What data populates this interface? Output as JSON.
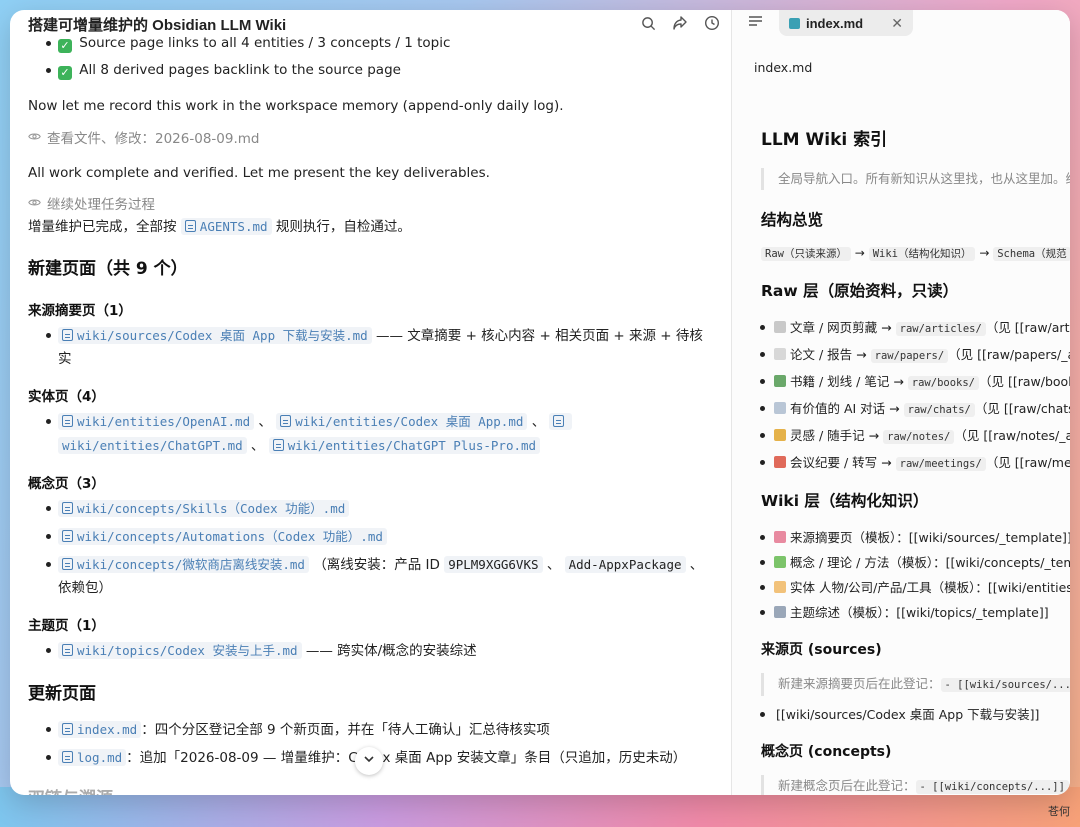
{
  "left": {
    "title": "搭建可增量维护的 Obsidian LLM Wiki",
    "top_items": [
      "Source page links to all 4 entities / 3 concepts / 1 topic",
      "All 8 derived pages backlink to the source page"
    ],
    "para1": "Now let me record this work in the workspace memory (append-only daily log).",
    "tool1": "查看文件、修改：2026-08-09.md",
    "para2": "All work complete and verified. Let me present the key deliverables.",
    "tool2": "继续处理任务过程",
    "summary_pre": "增量维护已完成，全部按",
    "summary_file": "AGENTS.md",
    "summary_post": "规则执行，自检通过。",
    "h_new": "新建页面（共 9 个）",
    "src_h": "来源摘要页（1）",
    "src_file": "wiki/sources/Codex 桌面 App 下载与安装.md",
    "src_desc": "—— 文章摘要 + 核心内容 + 相关页面 + 来源 + 待核实",
    "ent_h": "实体页（4）",
    "ent_files": [
      "wiki/entities/OpenAI.md",
      "wiki/entities/Codex 桌面 App.md",
      "wiki/entities/ChatGPT.md",
      "wiki/entities/ChatGPT Plus-Pro.md"
    ],
    "sep": "、",
    "con_h": "概念页（3）",
    "con_files": [
      "wiki/concepts/Skills（Codex 功能）.md",
      "wiki/concepts/Automations（Codex 功能）.md",
      "wiki/concepts/微软商店离线安装.md"
    ],
    "con3_desc1": "（离线安装：产品 ID",
    "con3_code1": "9PLM9XGG6VKS",
    "con3_code2": "Add-AppxPackage",
    "con3_desc2": "依赖包）",
    "top_h": "主题页（1）",
    "top_file": "wiki/topics/Codex 安装与上手.md",
    "top_desc": "—— 跨实体/概念的安装综述",
    "h_upd": "更新页面",
    "upd_index_file": "index.md",
    "upd_index_desc": "：四个分区登记全部 9 个新页面，并在「待人工确认」汇总待核实项",
    "upd_log_file": "log.md",
    "upd_log_desc": "：追加「2026-08-09 — 增量维护：Codex 桌面 App 安装文章」条目（只追加，历史未动）",
    "h_links": "双链与溯源"
  },
  "right": {
    "tab_label": "index.md",
    "close": "✕",
    "filename": "index.md",
    "h1": "LLM Wiki 索引",
    "quote1": "全局导航入口。所有新知识从这里找，也从这里加。维",
    "h_struct": "结构总览",
    "flow": [
      "Raw（只读来源）",
      "Wiki（结构化知识）",
      "Schema（规范"
    ],
    "arrow": "→",
    "h_raw": "Raw 层（原始资料，只读）",
    "raw_items": [
      {
        "emoji_color": "#c9c9c9",
        "label": "文章 / 网页剪藏",
        "code": "raw/articles/",
        "tail": "（见 [[raw/artic"
      },
      {
        "emoji_color": "#d8d8d8",
        "label": "论文 / 报告",
        "code": "raw/papers/",
        "tail": "（见 [[raw/papers/_ab"
      },
      {
        "emoji_color": "#6aa86a",
        "label": "书籍 / 划线 / 笔记",
        "code": "raw/books/",
        "tail": "（见 [[raw/books"
      },
      {
        "emoji_color": "#b9c6d6",
        "label": "有价值的 AI 对话",
        "code": "raw/chats/",
        "tail": "（见 [[raw/chats/"
      },
      {
        "emoji_color": "#e5b24a",
        "label": "灵感 / 随手记",
        "code": "raw/notes/",
        "tail": "（见 [[raw/notes/_ab"
      },
      {
        "emoji_color": "#e06a5a",
        "label": "会议纪要 / 转写",
        "code": "raw/meetings/",
        "tail": "（见 [[raw/mee"
      }
    ],
    "h_wiki": "Wiki 层（结构化知识）",
    "wiki_items": [
      {
        "emoji_color": "#e88aa0",
        "text": "来源摘要页（模板）：[[wiki/sources/_template]]"
      },
      {
        "emoji_color": "#7cc46a",
        "text": "概念 / 理论 / 方法（模板）：[[wiki/concepts/_temp"
      },
      {
        "emoji_color": "#f2c27a",
        "text": "实体 人物/公司/产品/工具（模板）：[[wiki/entities/_"
      },
      {
        "emoji_color": "#9aa7b8",
        "text": "主题综述（模板）：[[wiki/topics/_template]]"
      }
    ],
    "h_sources": "来源页 (sources)",
    "src_quote_pre": "新建来源摘要页后在此登记：",
    "src_quote_code": "- [[wiki/sources/...]]",
    "src_item": "[[wiki/sources/Codex 桌面 App 下载与安装]]",
    "h_concepts": "概念页 (concepts)",
    "con_quote_pre": "新建概念页后在此登记：",
    "con_quote_code": "- [[wiki/concepts/...]]"
  },
  "watermark": "苍何"
}
